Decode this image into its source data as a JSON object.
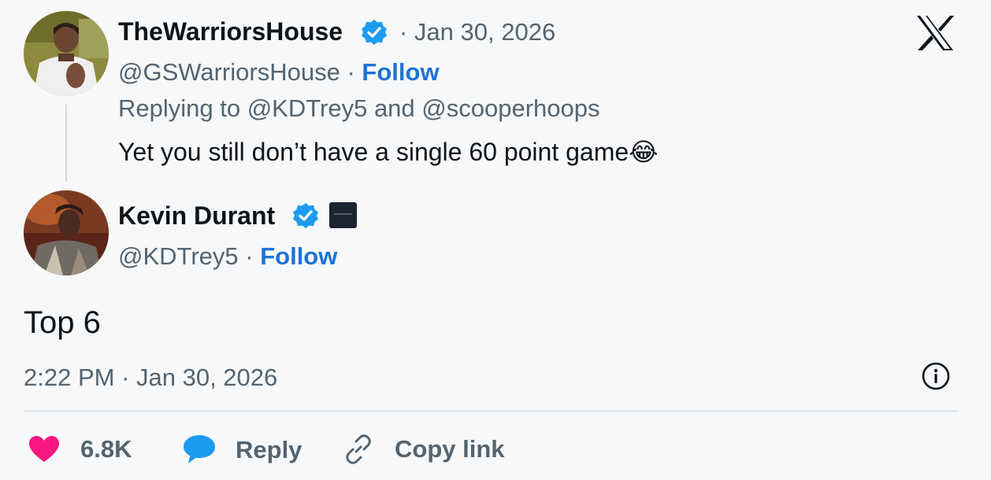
{
  "reply_tweet": {
    "display_name": "TheWarriorsHouse",
    "date": "· Jan 30, 2026",
    "handle": "@GSWarriorsHouse",
    "separator": "·",
    "follow_label": "Follow",
    "replying_to": "Replying to @KDTrey5 and @scooperhoops",
    "text": "Yet you still don’t have a single 60 point game",
    "emoji": "😂"
  },
  "main_tweet": {
    "display_name": "Kevin Durant",
    "handle": "@KDTrey5",
    "separator": "·",
    "follow_label": "Follow",
    "text": "Top 6",
    "timestamp": "2:22 PM · Jan 30, 2026"
  },
  "actions": {
    "like_count": "6.8K",
    "reply_label": "Reply",
    "copy_link_label": "Copy link"
  },
  "icons": {
    "logo": "x-logo-icon",
    "verified": "verified-badge-icon",
    "affiliate": "affiliate-badge-icon",
    "info": "info-icon",
    "like": "heart-icon",
    "reply": "speech-bubble-icon",
    "link": "link-icon"
  },
  "colors": {
    "verified_blue": "#1d9bf0",
    "follow_blue": "#1d73d8",
    "like_pink": "#f91880",
    "muted_text": "#536471"
  }
}
